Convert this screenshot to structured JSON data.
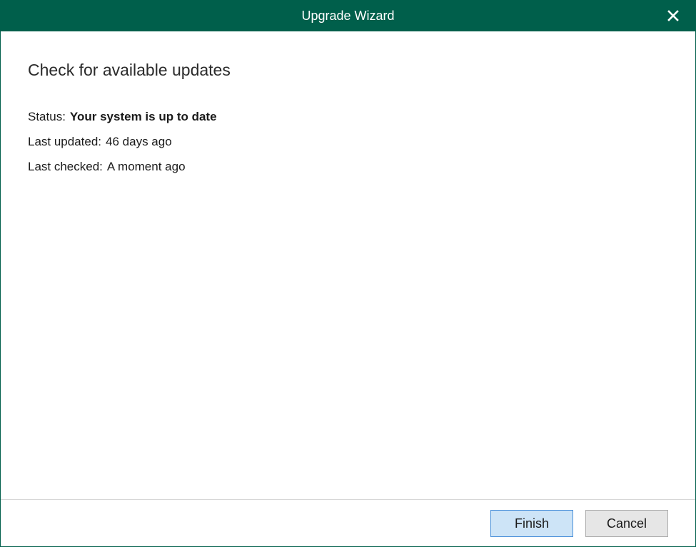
{
  "window": {
    "title": "Upgrade Wizard"
  },
  "page": {
    "heading": "Check for available updates"
  },
  "info": {
    "status_label": "Status:",
    "status_value": "Your system is up to date",
    "last_updated_label": "Last updated:",
    "last_updated_value": "46 days ago",
    "last_checked_label": "Last checked:",
    "last_checked_value": "A moment ago"
  },
  "buttons": {
    "finish_label": "Finish",
    "cancel_label": "Cancel"
  },
  "icons": {
    "close": "close-icon"
  },
  "colors": {
    "titlebar": "#005f4b",
    "primary_button_bg": "#cde4f7",
    "primary_button_border": "#4a90d9",
    "secondary_button_bg": "#e6e6e6"
  }
}
